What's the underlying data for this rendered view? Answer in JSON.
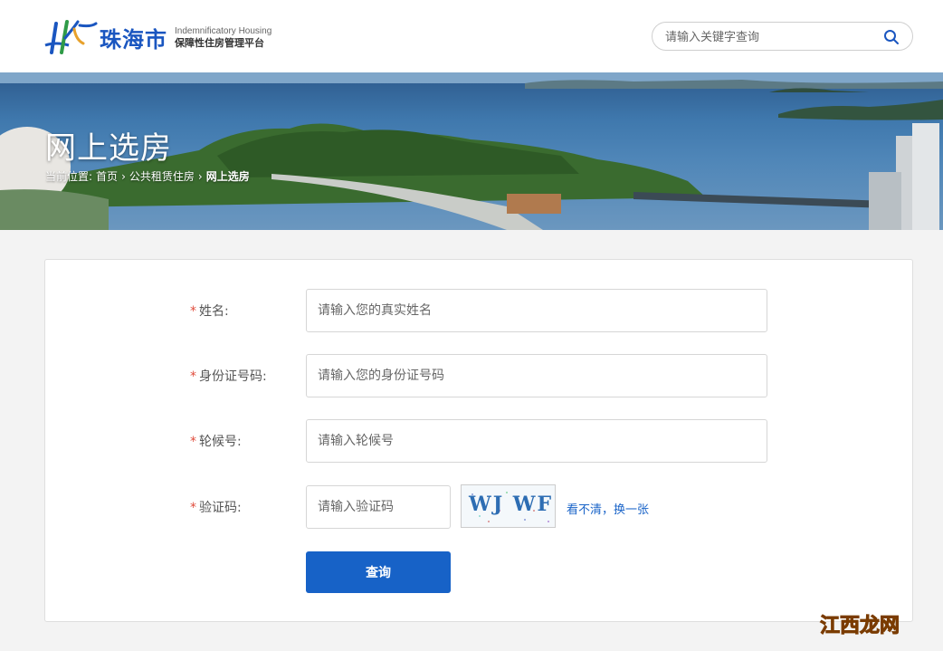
{
  "header": {
    "logo_city": "珠海市",
    "logo_en": "Indemnificatory Housing",
    "logo_cn": "保障性住房管理平台",
    "search_placeholder": "请输入关键字查询"
  },
  "banner": {
    "title": "网上选房",
    "breadcrumb_prefix": "当前位置:",
    "breadcrumb": [
      "首页",
      "公共租赁住房",
      "网上选房"
    ],
    "separator": "›"
  },
  "form": {
    "required_mark": "*",
    "fields": [
      {
        "label": "姓名:",
        "placeholder": "请输入您的真实姓名"
      },
      {
        "label": "身份证号码:",
        "placeholder": "请输入您的身份证号码"
      },
      {
        "label": "轮候号:",
        "placeholder": "请输入轮候号"
      },
      {
        "label": "验证码:",
        "placeholder": "请输入验证码"
      }
    ],
    "captcha_text": "WJ WF",
    "refresh_label": "看不清，换一张",
    "submit_label": "查询"
  },
  "watermark": {
    "part1": "江西",
    "part2": "龙网"
  },
  "colors": {
    "primary": "#1762c7",
    "required": "#e04c3c",
    "link": "#1a64c8",
    "logo_blue": "#1a56c0"
  },
  "icons": {
    "search": "search-icon"
  }
}
